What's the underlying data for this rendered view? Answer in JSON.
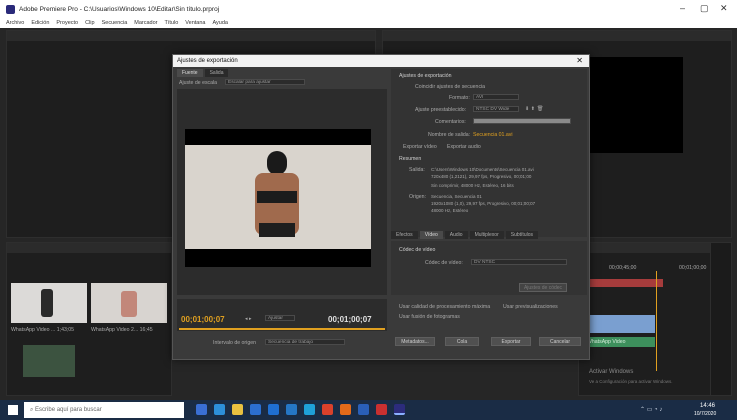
{
  "window": {
    "title": "Adobe Premiere Pro - C:\\Usuarios\\Windows 10\\Editar\\Sin título.prproj",
    "min_glyph": "–",
    "max_glyph": "▢",
    "close_glyph": "✕"
  },
  "menu": [
    "Archivo",
    "Edición",
    "Proyecto",
    "Clip",
    "Secuencia",
    "Marcador",
    "Título",
    "Ventana",
    "Ayuda"
  ],
  "dialog": {
    "title": "Ajustes de exportación",
    "close_glyph": "✕",
    "tabs": [
      "Fuente",
      "Salida"
    ],
    "source_scaling_label": "Ajuste de escala",
    "source_scaling_value": "Escalar para ajustar",
    "left_timecode": "00;01;00;07",
    "right_timecode": "00;01;00;07",
    "fit_label": "Ajustar",
    "range_label": "Intervalo de origen",
    "range_value": "Secuencia de trabajo",
    "export_settings_header": "Ajustes de exportación",
    "match_sequence_label": "Coincidir ajustes de secuencia",
    "format_label": "Formato:",
    "format_value": "AVI",
    "preset_label": "Ajuste preestablecido:",
    "preset_value": "NTSC DV Wide",
    "comments_label": "Comentarios:",
    "output_name_label": "Nombre de salida:",
    "output_name_value": "Secuencia 01.avi",
    "export_video_label": "Exportar vídeo",
    "export_audio_label": "Exportar audio",
    "summary_header": "Resumen",
    "output_label": "Salida:",
    "output_line1": "C:\\Users\\Windows 10\\Documents\\Secuencia 01.avi",
    "output_line2": "720x480 (1,2121), 29,97 fps, Progresivo, 00;01;00",
    "output_line3": "Sin comprimir, 48000 Hz, Estéreo, 16 bits",
    "source_label": "Origen:",
    "source_line1": "Secuencia, Secuencia 01",
    "source_line2": "1920x1080 (1,0), 29,97 fps, Progresivo, 00;01;00;07",
    "source_line3": "48000 Hz, Estéreo",
    "lower_tabs": [
      "Efectos",
      "Vídeo",
      "Audio",
      "Multiplexor",
      "Subtítulos"
    ],
    "video_codec_header": "Códec de vídeo",
    "video_codec_label": "Códec de vídeo:",
    "video_codec_value": "DV NTSC",
    "codec_settings_button": "Ajustes de códec",
    "max_render_quality_label": "Usar calidad de procesamiento máxima",
    "use_previews_label": "Usar previsualizaciones",
    "frame_blending_label": "Usar fusión de fotogramas",
    "metadata_button": "Metadatos...",
    "queue_button": "Cola",
    "export_button": "Exportar",
    "cancel_button": "Cancelar"
  },
  "timeline": {
    "timecode_left": "00;00;45;00",
    "timecode_right": "00;01;00;00",
    "clip_label": "WhatsApp Video"
  },
  "project": {
    "clip1": "WhatsApp Video ... 1;43;05",
    "clip2": "WhatsApp Video 2... 16;45"
  },
  "watermark": {
    "line1": "Activar Windows",
    "line2": "Ve a Configuración para activar Windows."
  },
  "taskbar": {
    "search_placeholder": "Escribe aquí para buscar",
    "time": "14:46",
    "date": "10/7/2020"
  }
}
